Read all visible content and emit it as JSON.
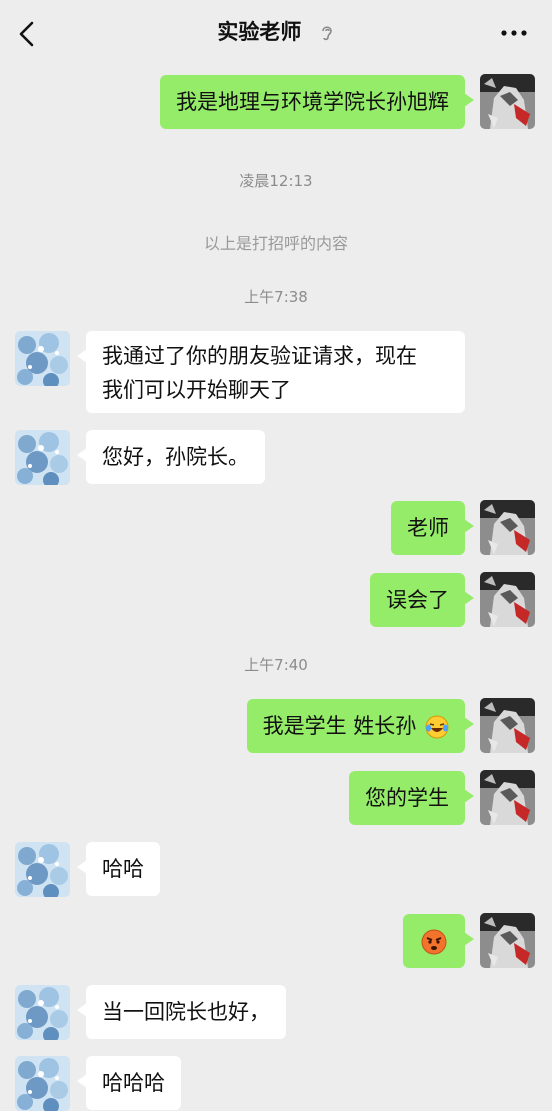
{
  "header": {
    "title": "实验老师",
    "back_icon": "chevron-left-icon",
    "ear_icon": "ear-icon",
    "more_icon": "more-dots-icon"
  },
  "colors": {
    "background": "#ededed",
    "my_bubble": "#95ec69",
    "other_bubble": "#ffffff",
    "timestamp_text": "#8c8c8c"
  },
  "messages": [
    {
      "type": "text",
      "sender": "me",
      "text": "我是地理与环境学院长孙旭辉"
    },
    {
      "type": "time",
      "text": "凌晨12:13"
    },
    {
      "type": "system",
      "text": "以上是打招呼的内容"
    },
    {
      "type": "time",
      "text": "上午7:38"
    },
    {
      "type": "text",
      "sender": "other",
      "lines": [
        "我通过了你的朋友验证请求，现在",
        "我们可以开始聊天了"
      ]
    },
    {
      "type": "text",
      "sender": "other",
      "text": "您好，孙院长。"
    },
    {
      "type": "text",
      "sender": "me",
      "text": "老师"
    },
    {
      "type": "text",
      "sender": "me",
      "text": "误会了"
    },
    {
      "type": "time",
      "text": "上午7:40"
    },
    {
      "type": "text",
      "sender": "me",
      "text": "我是学生  姓长孙",
      "emoji": "laughing-crying-emoji"
    },
    {
      "type": "text",
      "sender": "me",
      "text": "您的学生"
    },
    {
      "type": "text",
      "sender": "other",
      "text": "哈哈"
    },
    {
      "type": "emoji",
      "sender": "me",
      "emoji": "angry-face-emoji"
    },
    {
      "type": "text",
      "sender": "other",
      "text": "当一回院长也好，"
    },
    {
      "type": "text",
      "sender": "other",
      "text": "哈哈哈"
    }
  ]
}
